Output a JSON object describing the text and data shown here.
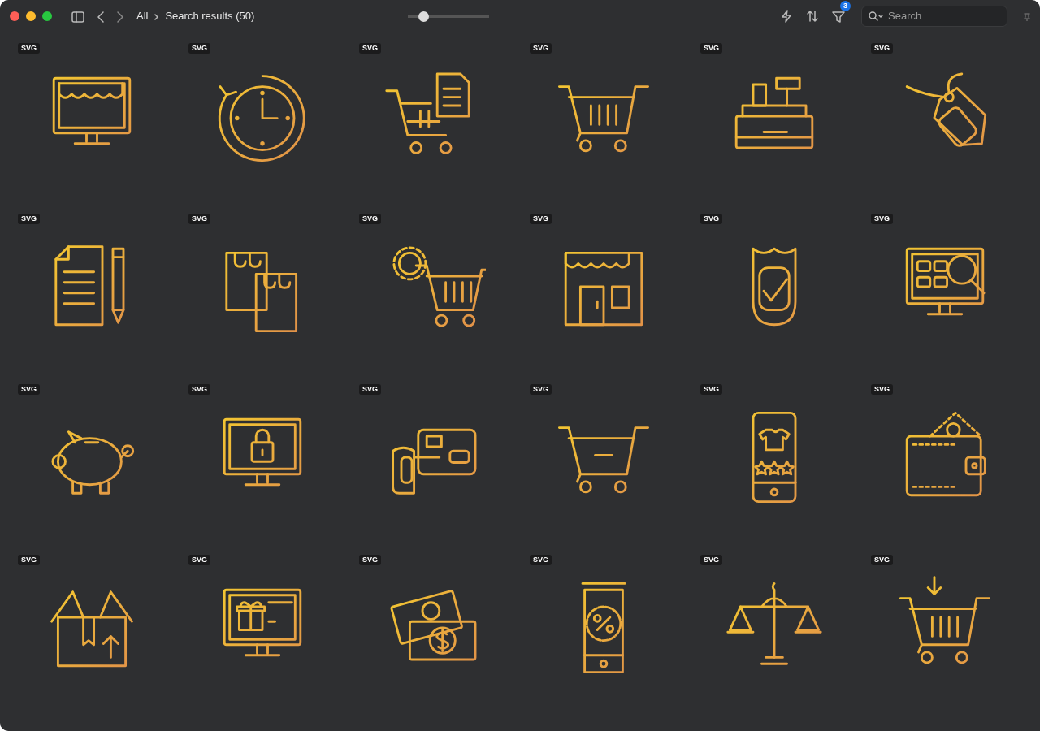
{
  "toolbar": {
    "breadcrumb": [
      "All",
      "Search results (50)"
    ],
    "zoom_slider": {
      "level": 0.19
    },
    "filter_count": "3",
    "search": {
      "placeholder": "Search"
    }
  },
  "items": [
    {
      "badge": "SVG"
    },
    {
      "badge": "SVG"
    },
    {
      "badge": "SVG"
    },
    {
      "badge": "SVG"
    },
    {
      "badge": "SVG"
    },
    {
      "badge": "SVG"
    },
    {
      "badge": "SVG"
    },
    {
      "badge": "SVG"
    },
    {
      "badge": "SVG"
    },
    {
      "badge": "SVG"
    },
    {
      "badge": "SVG"
    },
    {
      "badge": "SVG"
    },
    {
      "badge": "SVG"
    },
    {
      "badge": "SVG"
    },
    {
      "badge": "SVG"
    },
    {
      "badge": "SVG"
    },
    {
      "badge": "SVG"
    },
    {
      "badge": "SVG"
    },
    {
      "badge": "SVG"
    },
    {
      "badge": "SVG"
    },
    {
      "badge": "SVG"
    },
    {
      "badge": "SVG"
    },
    {
      "badge": "SVG"
    },
    {
      "badge": "SVG"
    }
  ]
}
